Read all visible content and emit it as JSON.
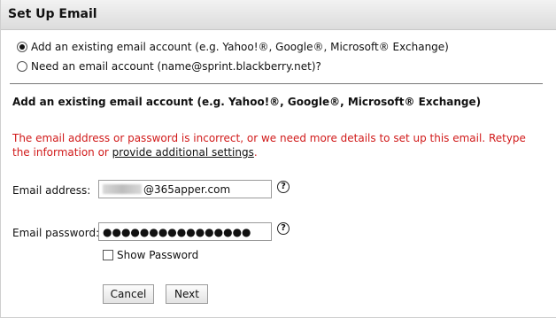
{
  "header": {
    "title": "Set Up Email"
  },
  "options": [
    {
      "label": "Add an existing email account (e.g. Yahoo!®, Google®, Microsoft® Exchange)",
      "selected": true
    },
    {
      "label": "Need an email account (name@sprint.blackberry.net)?",
      "selected": false
    }
  ],
  "section": {
    "title": "Add an existing email account (e.g. Yahoo!®, Google®, Microsoft® Exchange)"
  },
  "error": {
    "message_prefix": "The email address or password is incorrect, or we need more details to set up this email. Retype the information or ",
    "link_text": "provide additional settings",
    "message_suffix": "."
  },
  "form": {
    "email_label": "Email address:",
    "email_value_visible": "@365apper.com",
    "password_label": "Email password:",
    "password_masked": "●●●●●●●●●●●●●●●●",
    "help_glyph": "?",
    "show_password_label": "Show Password",
    "show_password_checked": false
  },
  "buttons": {
    "cancel": "Cancel",
    "next": "Next"
  },
  "colors": {
    "error": "#d11a1a",
    "header_bg": "#e4e4e4"
  }
}
